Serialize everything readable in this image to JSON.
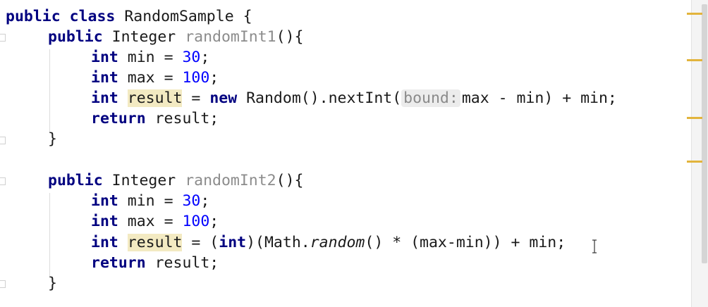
{
  "code": {
    "class_decl": {
      "kw1": "public",
      "kw2": "class",
      "name": "RandomSample",
      "brace": " {"
    },
    "method1": {
      "kw": "public",
      "type": "Integer",
      "name": "randomInt1",
      "suffix": "(){",
      "line_min": {
        "kw": "int",
        "rest": " min = ",
        "num": "30",
        "end": ";"
      },
      "line_max": {
        "kw": "int",
        "rest": " max = ",
        "num": "100",
        "end": ";"
      },
      "line_result": {
        "kw": "int",
        "var": "result",
        "eq": " = ",
        "new_kw": "new",
        "call": " Random().nextInt(",
        "hint": "bound:",
        "expr": "max - min) + min;"
      },
      "line_return": {
        "kw": "return",
        "rest": " result;"
      },
      "close": "}"
    },
    "method2": {
      "kw": "public",
      "type": "Integer",
      "name": "randomInt2",
      "suffix": "(){",
      "line_min": {
        "kw": "int",
        "rest": " min = ",
        "num": "30",
        "end": ";"
      },
      "line_max": {
        "kw": "int",
        "rest": " max = ",
        "num": "100",
        "end": ";"
      },
      "line_result": {
        "kw": "int",
        "var": "result",
        "eq": " = (",
        "cast_kw": "int",
        "mid": ")(Math.",
        "method": "random",
        "tail": "() * (max-min)) + min;"
      },
      "line_return": {
        "kw": "return",
        "rest": " result;"
      },
      "close": "}"
    }
  },
  "scrollbar": {
    "marker_color": "#e2b43c"
  }
}
